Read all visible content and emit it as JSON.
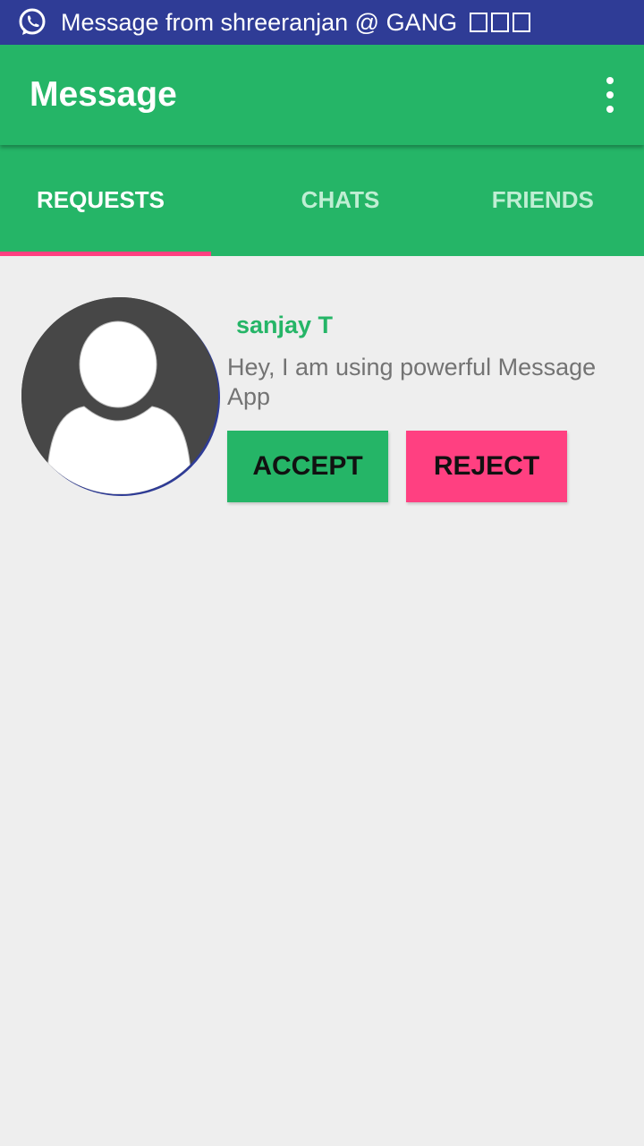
{
  "status_bar": {
    "notification_icon": "whatsapp-icon",
    "notification_text": "Message from shreeranjan @ GANG",
    "trailing_glyphs": [
      "□",
      "□",
      "□"
    ],
    "background_color": "#2f3c96"
  },
  "toolbar": {
    "title": "Message",
    "menu_icon": "more-vert-icon",
    "background_color": "#25b567"
  },
  "tabs": {
    "items": [
      {
        "label": "REQUESTS",
        "active": true
      },
      {
        "label": "CHATS",
        "active": false
      },
      {
        "label": "FRIENDS",
        "active": false
      }
    ],
    "indicator_color": "#ff4081"
  },
  "requests": [
    {
      "avatar_icon": "default-avatar-icon",
      "name": "sanjay T",
      "status": "Hey, I am using powerful Message App",
      "accept_label": "ACCEPT",
      "reject_label": "REJECT"
    }
  ],
  "colors": {
    "primary": "#25b567",
    "accent": "#ff4081",
    "background": "#eeeeee"
  }
}
